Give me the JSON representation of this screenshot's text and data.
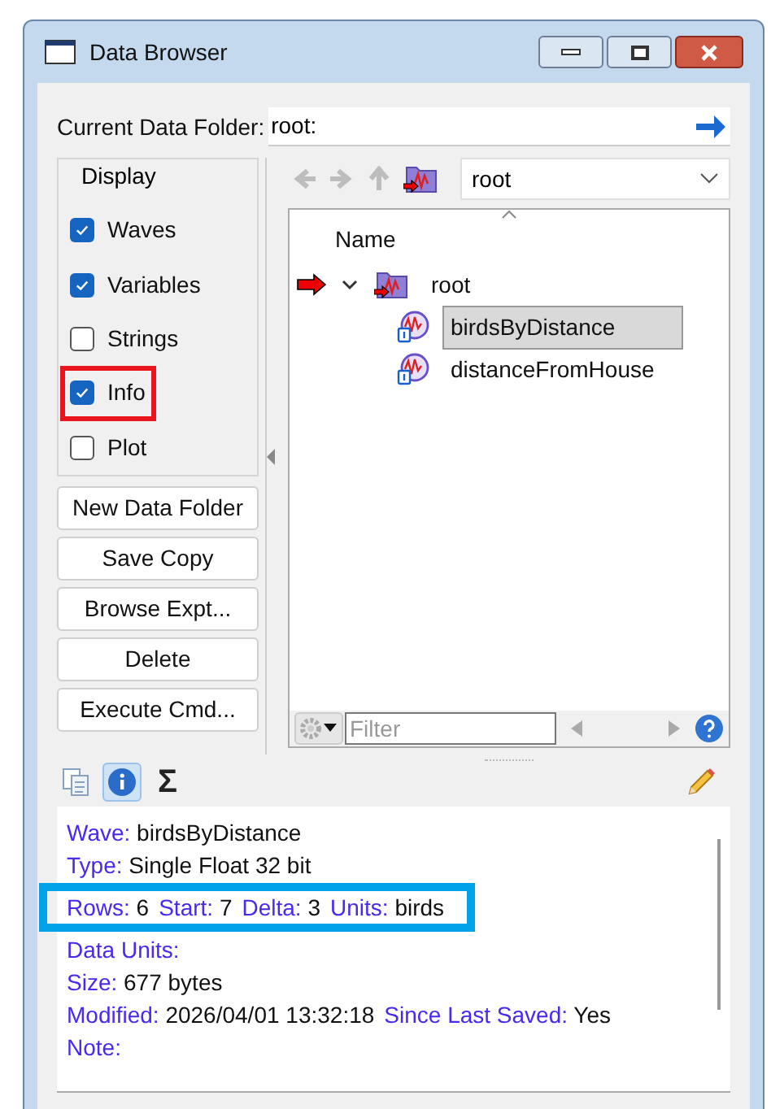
{
  "window": {
    "title": "Data Browser"
  },
  "current_folder": {
    "label": "Current Data Folder:",
    "value": "root:"
  },
  "display": {
    "title": "Display",
    "options": [
      {
        "label": "Waves",
        "checked": true,
        "highlighted": false
      },
      {
        "label": "Variables",
        "checked": true,
        "highlighted": false
      },
      {
        "label": "Strings",
        "checked": false,
        "highlighted": false
      },
      {
        "label": "Info",
        "checked": true,
        "highlighted": true
      },
      {
        "label": "Plot",
        "checked": false,
        "highlighted": false
      }
    ]
  },
  "buttons": [
    "New Data Folder",
    "Save Copy",
    "Browse Expt...",
    "Delete",
    "Execute Cmd..."
  ],
  "folder_dropdown": {
    "value": "root"
  },
  "tree": {
    "column": "Name",
    "items": [
      {
        "name": "root",
        "kind": "folder",
        "current": true,
        "expanded": true,
        "selected": false,
        "children": [
          {
            "name": "birdsByDistance",
            "kind": "wave",
            "selected": true
          },
          {
            "name": "distanceFromHouse",
            "kind": "wave",
            "selected": false
          }
        ]
      }
    ]
  },
  "filter": {
    "placeholder": "Filter"
  },
  "info_tabs": [
    {
      "kind": "list",
      "selected": false
    },
    {
      "kind": "info",
      "selected": true
    },
    {
      "kind": "sum",
      "label": "Σ",
      "selected": false
    }
  ],
  "info": [
    {
      "highlighted": false,
      "parts": [
        {
          "label": "Wave:",
          "value": "birdsByDistance"
        }
      ]
    },
    {
      "highlighted": false,
      "parts": [
        {
          "label": "Type:",
          "value": "Single Float 32 bit"
        }
      ]
    },
    {
      "highlighted": true,
      "parts": [
        {
          "label": "Rows:",
          "value": "6"
        },
        {
          "label": "Start:",
          "value": "7"
        },
        {
          "label": "Delta:",
          "value": "3"
        },
        {
          "label": "Units:",
          "value": "birds"
        }
      ]
    },
    {
      "highlighted": false,
      "parts": [
        {
          "label": "Data Units:"
        }
      ]
    },
    {
      "highlighted": false,
      "parts": [
        {
          "label": "Size:",
          "value": "677 bytes"
        }
      ]
    },
    {
      "highlighted": false,
      "parts": [
        {
          "label": "Modified:",
          "value": "2026/04/01 13:32:18"
        },
        {
          "label": "Since Last Saved:",
          "value": "Yes"
        }
      ]
    },
    {
      "highlighted": false,
      "parts": [
        {
          "label": "Note:"
        }
      ]
    }
  ]
}
